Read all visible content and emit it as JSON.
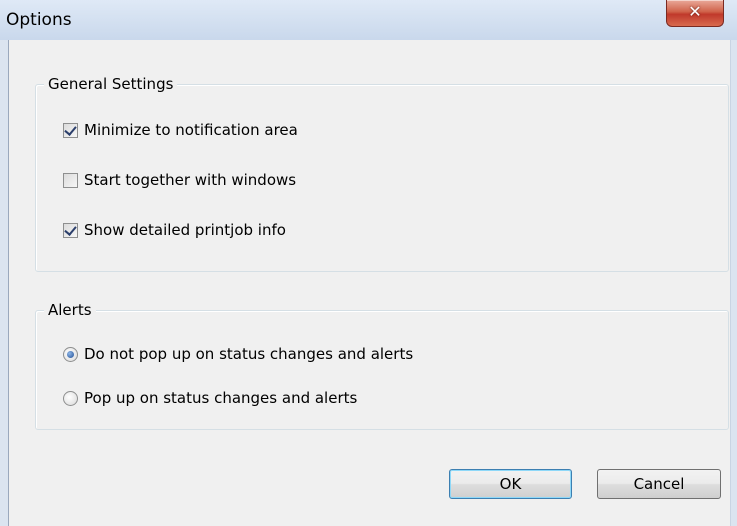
{
  "window": {
    "title": "Options",
    "close_glyph": "✕"
  },
  "general": {
    "legend": "General Settings",
    "options": [
      {
        "label": "Minimize to notification area",
        "checked": true
      },
      {
        "label": "Start together with windows",
        "checked": false
      },
      {
        "label": "Show detailed printjob info",
        "checked": true
      }
    ]
  },
  "alerts": {
    "legend": "Alerts",
    "options": [
      {
        "label": "Do not pop up on status changes and alerts",
        "selected": true
      },
      {
        "label": "Pop up on status changes and alerts",
        "selected": false
      }
    ]
  },
  "buttons": {
    "ok": "OK",
    "cancel": "Cancel"
  }
}
